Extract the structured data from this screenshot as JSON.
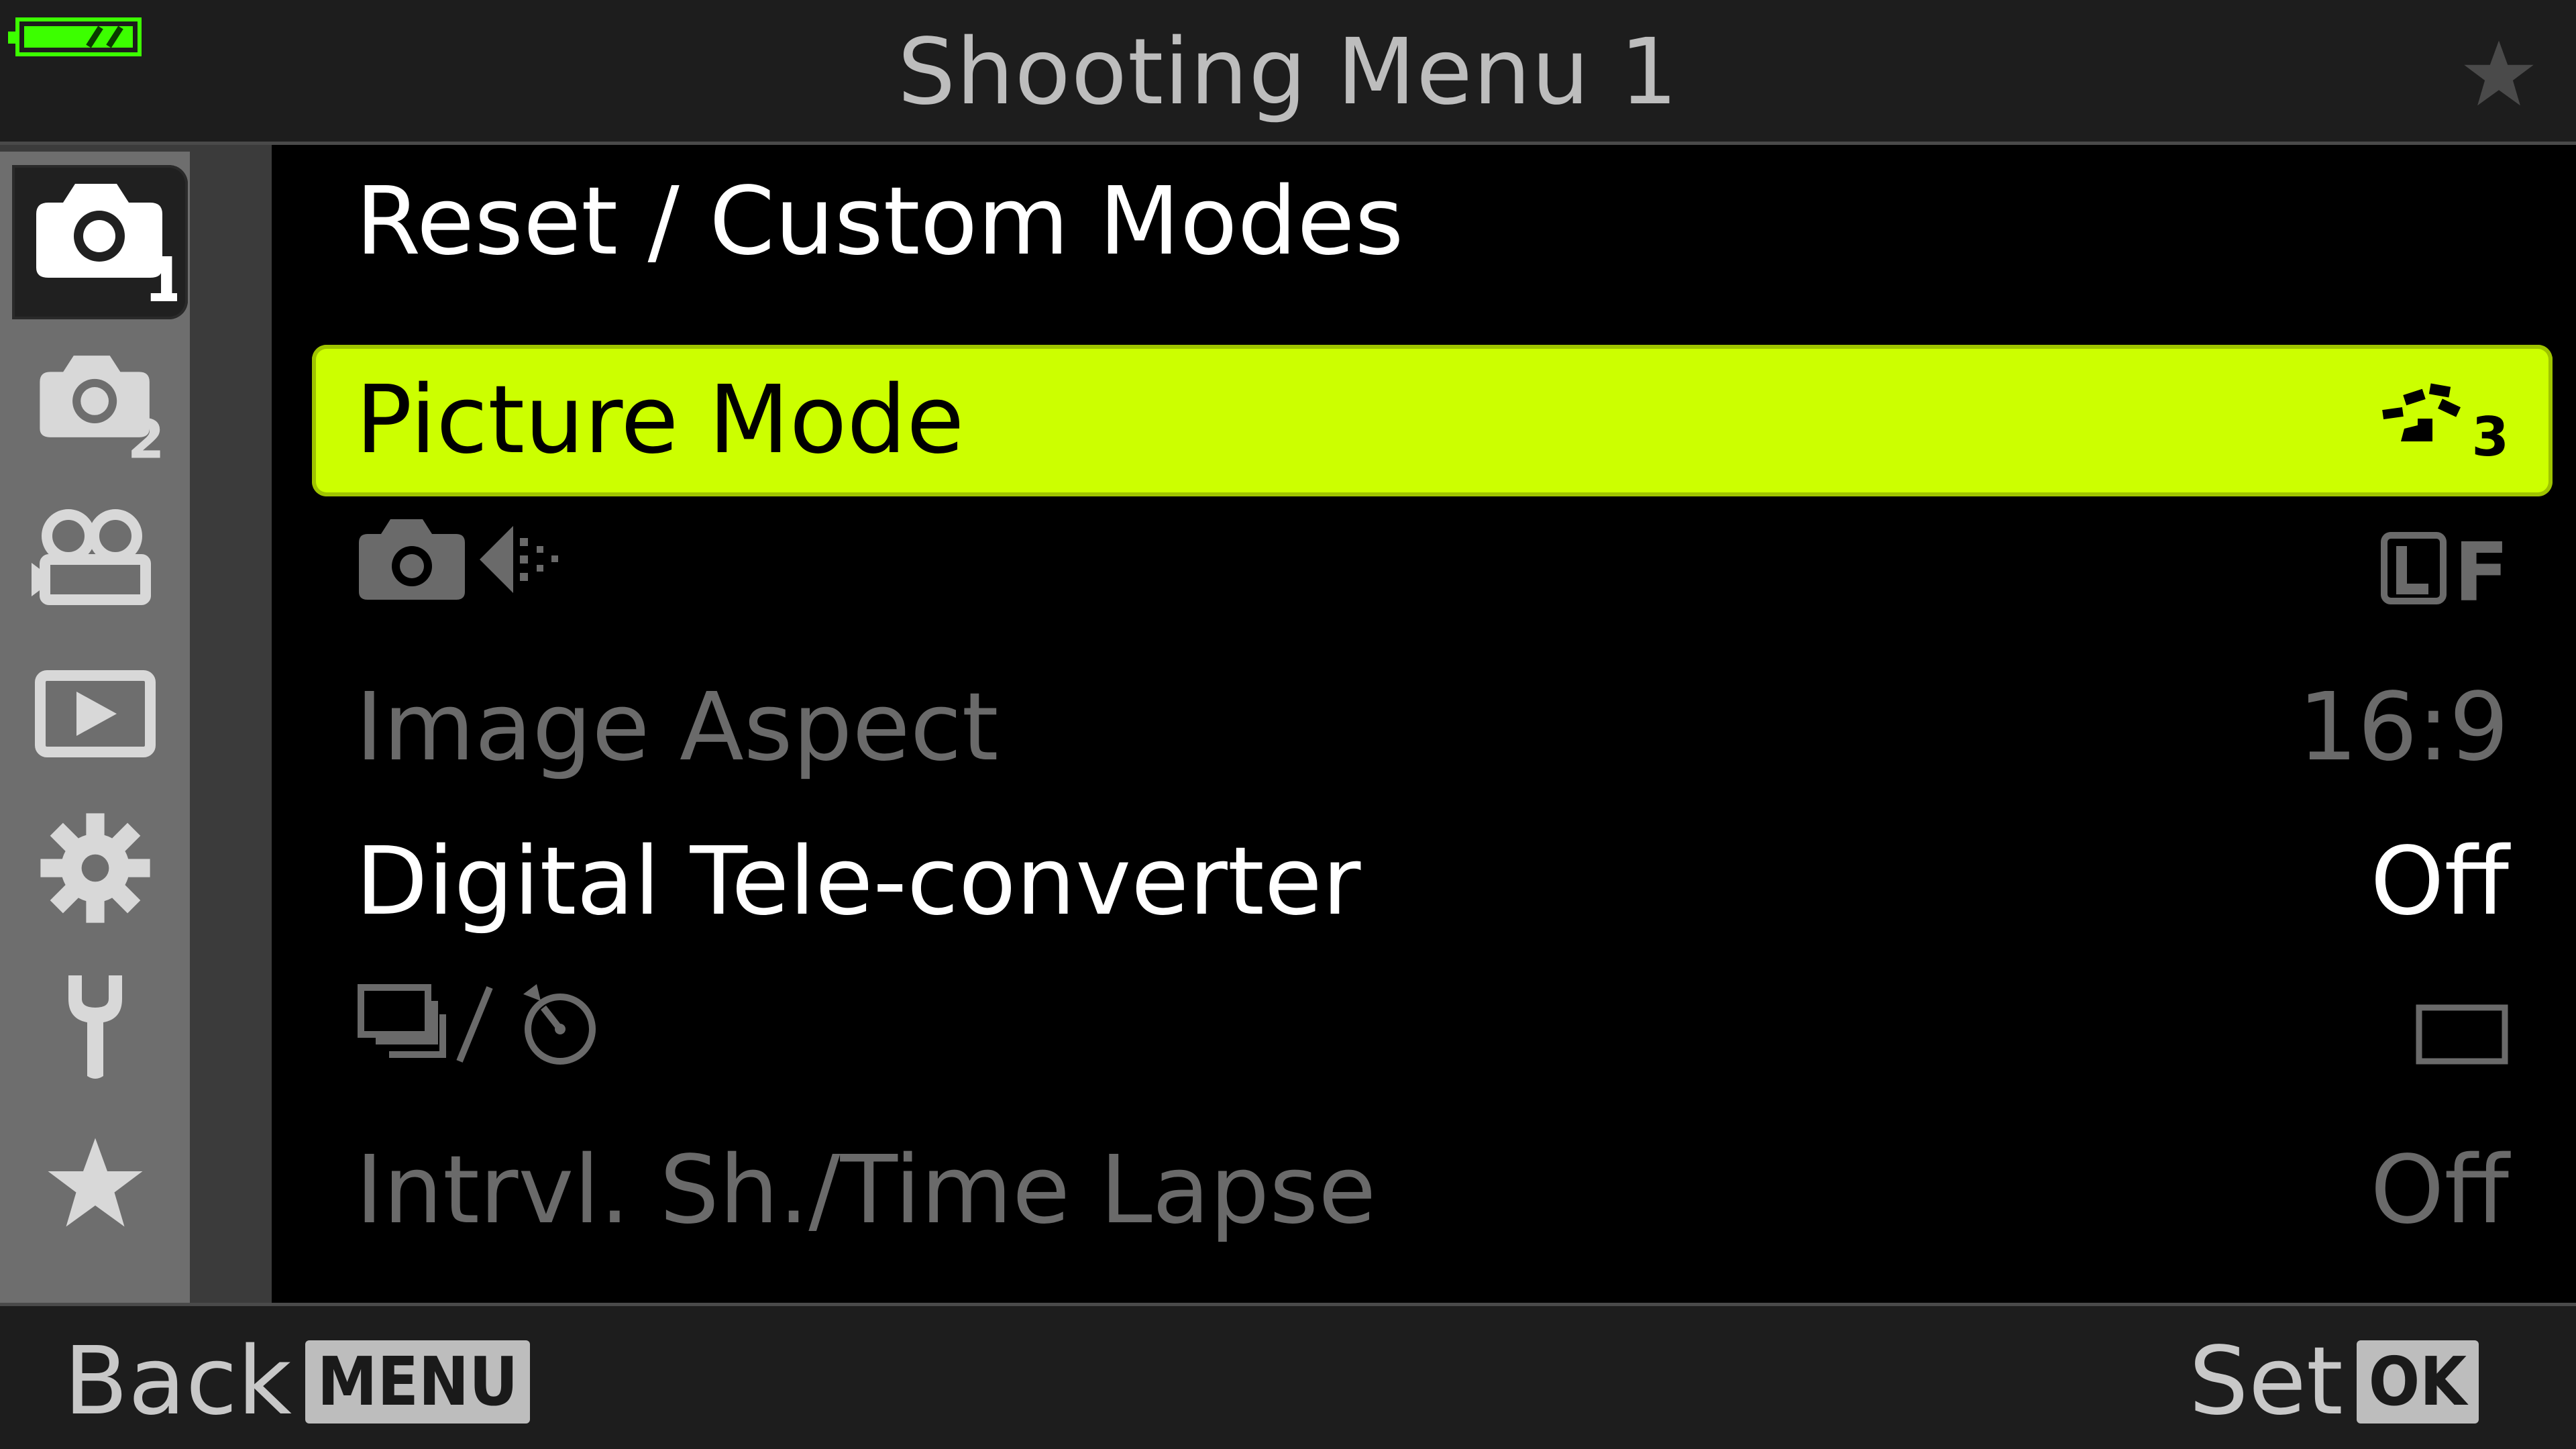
{
  "header": {
    "title": "Shooting Menu 1",
    "battery_icon": "battery-full-icon",
    "favorite_icon": "star-icon"
  },
  "sidebar": {
    "tabs": [
      {
        "icon": "camera-1-icon",
        "active": true
      },
      {
        "icon": "camera-2-icon",
        "active": false
      },
      {
        "icon": "movie-camera-icon",
        "active": false
      },
      {
        "icon": "playback-icon",
        "active": false
      },
      {
        "icon": "gear-icon",
        "active": false
      },
      {
        "icon": "wrench-icon",
        "active": false
      },
      {
        "icon": "star-icon",
        "active": false
      }
    ]
  },
  "menu": {
    "items": [
      {
        "label": "Reset / Custom Modes",
        "value": "",
        "state": "enabled"
      },
      {
        "label": "Picture Mode",
        "value_icon": "picture-mode-natural-icon",
        "value": "3",
        "state": "selected"
      },
      {
        "label_icon": "camera-quality-icon",
        "value": "F",
        "value_icon": "image-size-large-icon",
        "state": "disabled"
      },
      {
        "label": "Image Aspect",
        "value": "16:9",
        "state": "disabled"
      },
      {
        "label": "Digital Tele-converter",
        "value": "Off",
        "state": "enabled"
      },
      {
        "label_icon": "drive-self-timer-icon",
        "value_icon": "single-frame-icon",
        "state": "disabled"
      },
      {
        "label": "Intrvl. Sh./Time Lapse",
        "value": "Off",
        "state": "disabled"
      }
    ]
  },
  "footer": {
    "back_label": "Back",
    "back_key": "MENU",
    "set_label": "Set",
    "set_key": "OK"
  },
  "colors": {
    "highlight": "#ccff00",
    "battery": "#3cff00",
    "enabled_text": "#ffffff",
    "disabled_text": "#6a6a6a"
  }
}
